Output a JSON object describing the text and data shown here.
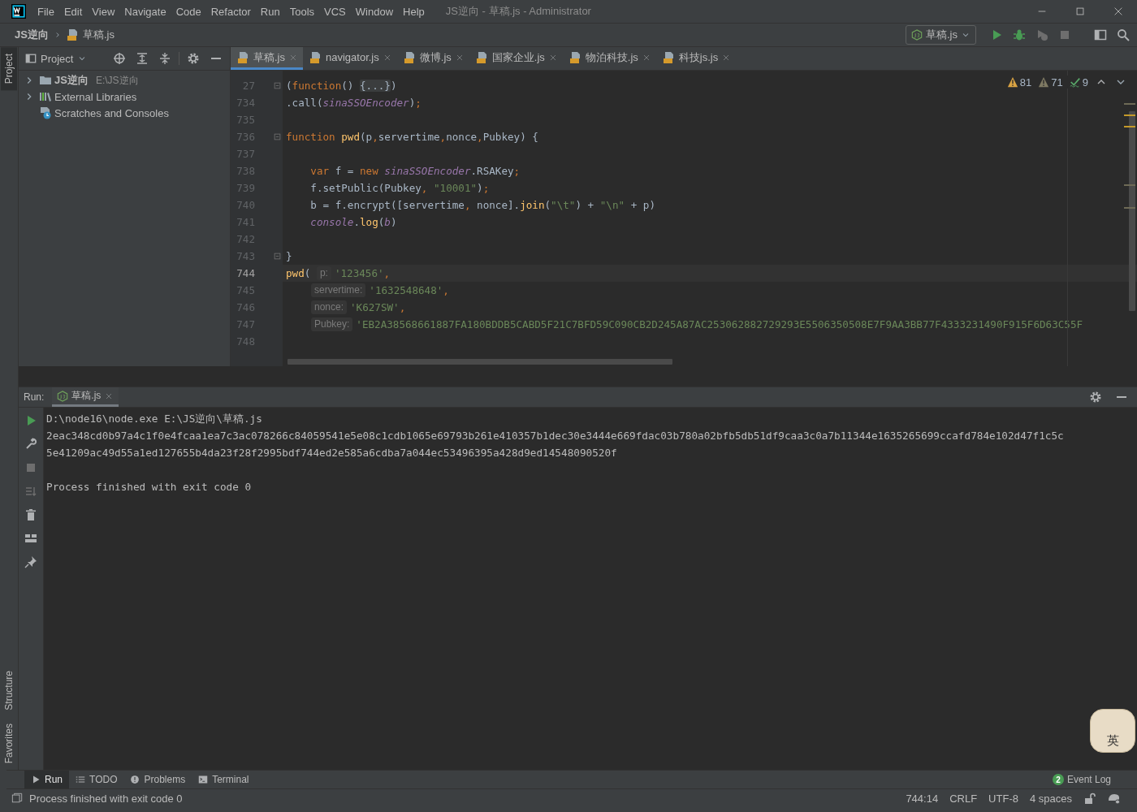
{
  "window": {
    "title": "JS逆向 - 草稿.js - Administrator"
  },
  "menu": [
    "File",
    "Edit",
    "View",
    "Navigate",
    "Code",
    "Refactor",
    "Run",
    "Tools",
    "VCS",
    "Window",
    "Help"
  ],
  "breadcrumbs": [
    {
      "label": "JS逆向",
      "kind": "folder"
    },
    {
      "label": "草稿.js",
      "kind": "file"
    }
  ],
  "run_config": {
    "label": "草稿.js"
  },
  "left_tabs_top": [
    {
      "label": "Project",
      "selected": true
    }
  ],
  "left_tabs_bottom": [
    {
      "label": "Structure",
      "selected": false
    },
    {
      "label": "Favorites",
      "selected": false
    }
  ],
  "project": {
    "title": "Project",
    "tree": [
      {
        "label": "JS逆向",
        "path": "E:\\JS逆向",
        "kind": "folder",
        "expanded": false
      },
      {
        "label": "External Libraries",
        "kind": "library",
        "expanded": false
      },
      {
        "label": "Scratches and Consoles",
        "kind": "scratch"
      }
    ]
  },
  "editor_tabs": [
    {
      "label": "草稿.js",
      "selected": true
    },
    {
      "label": "navigator.js",
      "selected": false
    },
    {
      "label": "微博.js",
      "selected": false
    },
    {
      "label": "国家企业.js",
      "selected": false
    },
    {
      "label": "物泊科技.js",
      "selected": false
    },
    {
      "label": "科技js.js",
      "selected": false
    }
  ],
  "inspections": [
    {
      "kind": "warning",
      "count": "81"
    },
    {
      "kind": "weak",
      "count": "71"
    },
    {
      "kind": "typo",
      "count": "9"
    }
  ],
  "code": [
    {
      "number": "27",
      "fold": true,
      "current": false,
      "tokens": [
        {
          "text": "(",
          "kind": "plain"
        },
        {
          "text": "function",
          "kind": "keyword"
        },
        {
          "text": "() ",
          "kind": "plain"
        },
        {
          "text": "{...}",
          "kind": "folded"
        },
        {
          "text": ")",
          "kind": "plain"
        }
      ]
    },
    {
      "number": "734",
      "fold": false,
      "current": false,
      "tokens": [
        {
          "text": ".call(",
          "kind": "plain"
        },
        {
          "text": "sinaSSOEncoder",
          "kind": "global"
        },
        {
          "text": ")",
          "kind": "plain"
        },
        {
          "text": ";",
          "kind": "keyword"
        }
      ]
    },
    {
      "number": "735",
      "fold": false,
      "current": false
    },
    {
      "number": "736",
      "fold": true,
      "current": false,
      "tokens": [
        {
          "text": "function ",
          "kind": "keyword"
        },
        {
          "text": "pwd",
          "kind": "func"
        },
        {
          "text": "(p",
          "kind": "plain"
        },
        {
          "text": ",",
          "kind": "keyword"
        },
        {
          "text": "servertime",
          "kind": "plain"
        },
        {
          "text": ",",
          "kind": "keyword"
        },
        {
          "text": "nonce",
          "kind": "plain"
        },
        {
          "text": ",",
          "kind": "keyword"
        },
        {
          "text": "Pubkey",
          "kind": "plain"
        },
        {
          "text": ") {",
          "kind": "plain"
        }
      ]
    },
    {
      "number": "737",
      "fold": false,
      "current": false
    },
    {
      "number": "738",
      "fold": false,
      "current": false,
      "tokens": [
        {
          "text": "    var ",
          "kind": "keyword"
        },
        {
          "text": "f = ",
          "kind": "plain"
        },
        {
          "text": "new ",
          "kind": "keyword"
        },
        {
          "text": "sinaSSOEncoder",
          "kind": "global"
        },
        {
          "text": ".RSAKey",
          "kind": "plain"
        },
        {
          "text": ";",
          "kind": "keyword"
        }
      ]
    },
    {
      "number": "739",
      "fold": false,
      "current": false,
      "tokens": [
        {
          "text": "    f.setPublic(Pubkey",
          "kind": "plain"
        },
        {
          "text": ", ",
          "kind": "keyword"
        },
        {
          "text": "\"10001\"",
          "kind": "string"
        },
        {
          "text": ")",
          "kind": "plain"
        },
        {
          "text": ";",
          "kind": "keyword"
        }
      ]
    },
    {
      "number": "740",
      "fold": false,
      "current": false,
      "tokens": [
        {
          "text": "    b = f.encrypt([servertime",
          "kind": "plain"
        },
        {
          "text": ", ",
          "kind": "keyword"
        },
        {
          "text": "nonce].",
          "kind": "plain"
        },
        {
          "text": "join",
          "kind": "func"
        },
        {
          "text": "(",
          "kind": "plain"
        },
        {
          "text": "\"\\t\"",
          "kind": "string"
        },
        {
          "text": ") + ",
          "kind": "plain"
        },
        {
          "text": "\"\\n\"",
          "kind": "string"
        },
        {
          "text": " + p)",
          "kind": "plain"
        }
      ]
    },
    {
      "number": "741",
      "fold": false,
      "current": false,
      "tokens": [
        {
          "text": "    console",
          "kind": "global"
        },
        {
          "text": ".",
          "kind": "plain"
        },
        {
          "text": "log",
          "kind": "func"
        },
        {
          "text": "(",
          "kind": "plain"
        },
        {
          "text": "b",
          "kind": "global"
        },
        {
          "text": ")",
          "kind": "plain"
        }
      ]
    },
    {
      "number": "742",
      "fold": false,
      "current": false
    },
    {
      "number": "743",
      "fold": true,
      "current": false,
      "tokens": [
        {
          "text": "}",
          "kind": "plain"
        }
      ]
    },
    {
      "number": "744",
      "fold": false,
      "current": true,
      "tokens": [
        {
          "text": "pwd",
          "kind": "func"
        },
        {
          "text": "( ",
          "kind": "plain"
        },
        {
          "text": "p:",
          "kind": "hint"
        },
        {
          "text": "'123456'",
          "kind": "string"
        },
        {
          "text": ",",
          "kind": "keyword"
        }
      ]
    },
    {
      "number": "745",
      "fold": false,
      "current": false,
      "continuation": true,
      "tokens": [
        {
          "text": "servertime:",
          "kind": "hint"
        },
        {
          "text": "'1632548648'",
          "kind": "string"
        },
        {
          "text": ",",
          "kind": "keyword"
        }
      ]
    },
    {
      "number": "746",
      "fold": false,
      "current": false,
      "continuation": true,
      "tokens": [
        {
          "text": "nonce:",
          "kind": "hint"
        },
        {
          "text": "'K627SW'",
          "kind": "string"
        },
        {
          "text": ",",
          "kind": "keyword"
        }
      ]
    },
    {
      "number": "747",
      "fold": false,
      "current": false,
      "continuation": true,
      "tokens": [
        {
          "text": "Pubkey:",
          "kind": "hint"
        },
        {
          "text": "'EB2A38568661887FA180BDDB5CABD5F21C7BFD59C090CB2D245A87AC253062882729293E5506350508E7F9AA3BB77F4333231490F915F6D63C55F",
          "kind": "string"
        }
      ]
    },
    {
      "number": "748",
      "fold": false,
      "current": false
    }
  ],
  "run": {
    "label": "Run:",
    "tab": "草稿.js",
    "output": [
      "D:\\node16\\node.exe E:\\JS逆向\\草稿.js",
      "2eac348cd0b97a4c1f0e4fcaa1ea7c3ac078266c84059541e5e08c1cdb1065e69793b261e410357b1dec30e3444e669fdac03b780a02bfb5db51df9caa3c0a7b11344e1635265699ccafd784e102d47f1c5c",
      "5e41209ac49d55a1ed127655b4da23f28f2995bdf744ed2e585a6cdba7a044ec53496395a428d9ed14548090520f"
    ],
    "exit": "Process finished with exit code 0"
  },
  "tool_windows": [
    {
      "label": "Run",
      "kind": "run",
      "selected": true
    },
    {
      "label": "TODO",
      "kind": "todo",
      "selected": false
    },
    {
      "label": "Problems",
      "kind": "problems",
      "selected": false
    },
    {
      "label": "Terminal",
      "kind": "terminal",
      "selected": false
    }
  ],
  "event_log": {
    "count": "2",
    "label": "Event Log"
  },
  "status": {
    "message": "Process finished with exit code 0",
    "position": "744:14",
    "line_separator": "CRLF",
    "encoding": "UTF-8",
    "indent": "4 spaces"
  },
  "ime": {
    "label": "英"
  }
}
